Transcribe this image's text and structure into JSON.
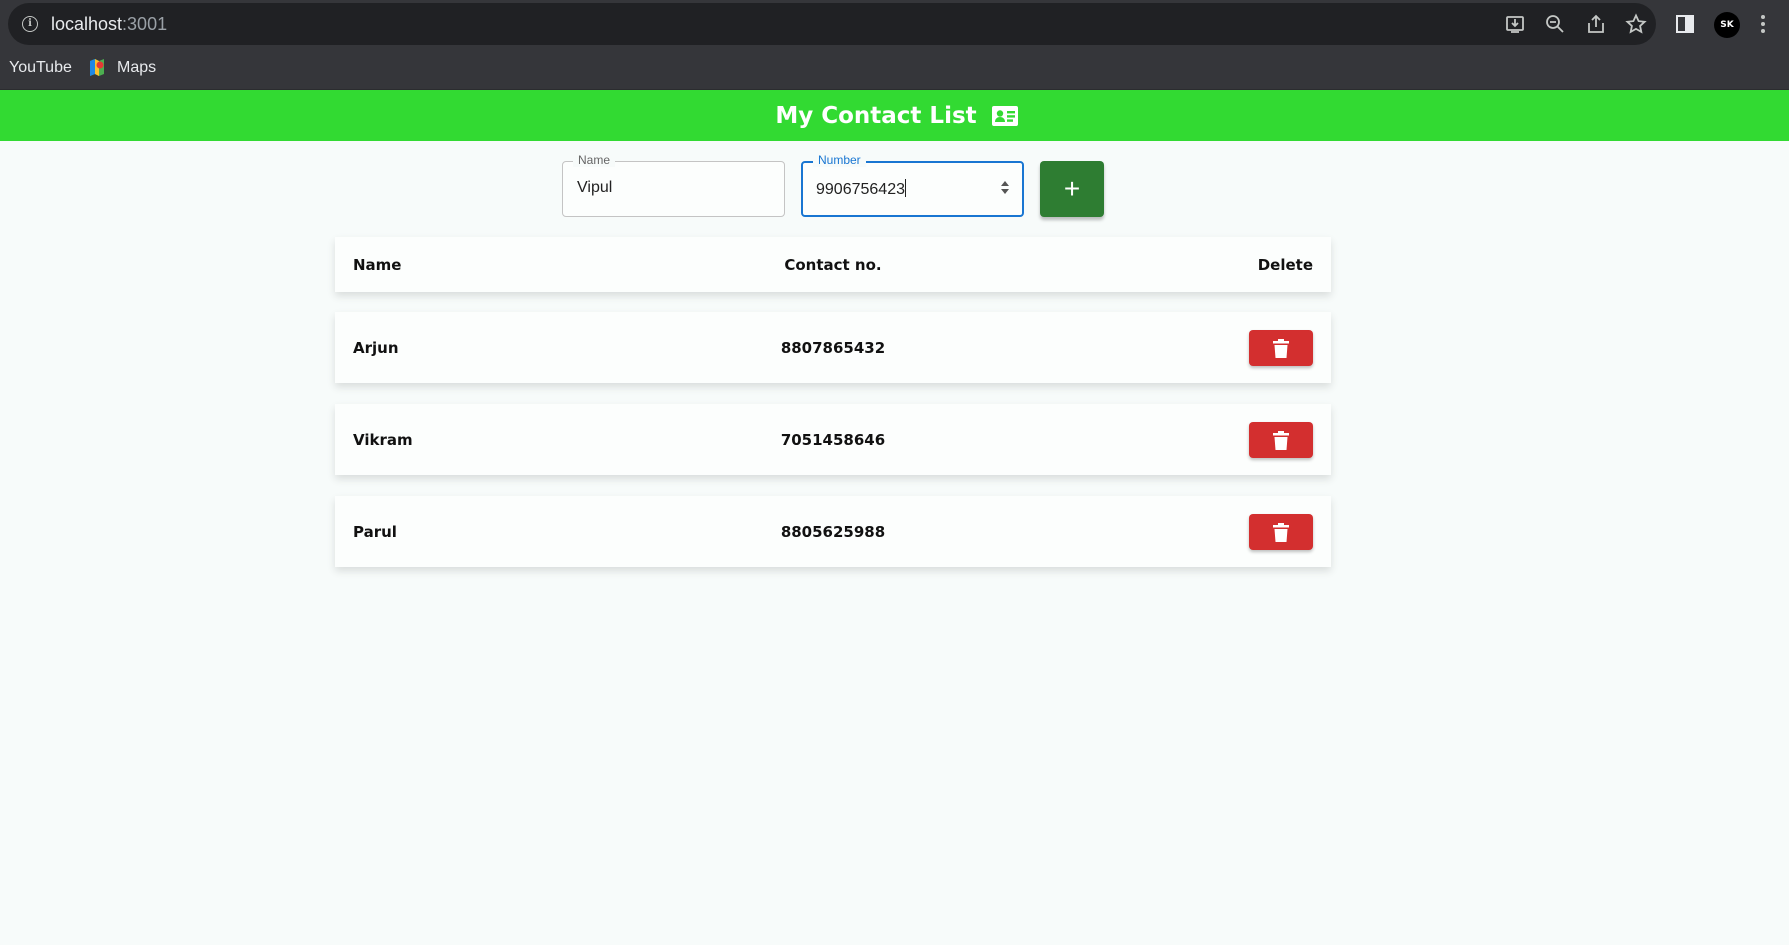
{
  "browser": {
    "url_host": "localhost",
    "url_port": ":3001",
    "bookmarks": [
      "YouTube",
      "Maps"
    ],
    "profile_initials": "SK"
  },
  "app": {
    "title": "My Contact List",
    "accent": "#32da32"
  },
  "form": {
    "name_label": "Name",
    "name_value": "Vipul",
    "number_label": "Number",
    "number_value": "9906756423",
    "add_label": "+"
  },
  "table": {
    "headers": [
      "Name",
      "Contact no.",
      "Delete"
    ],
    "rows": [
      {
        "name": "Arjun",
        "contact": "8807865432"
      },
      {
        "name": "Vikram",
        "contact": "7051458646"
      },
      {
        "name": "Parul",
        "contact": "8805625988"
      }
    ]
  },
  "colors": {
    "add_button": "#2e7d32",
    "delete_button": "#d32f2f",
    "focus": "#1976d2"
  }
}
